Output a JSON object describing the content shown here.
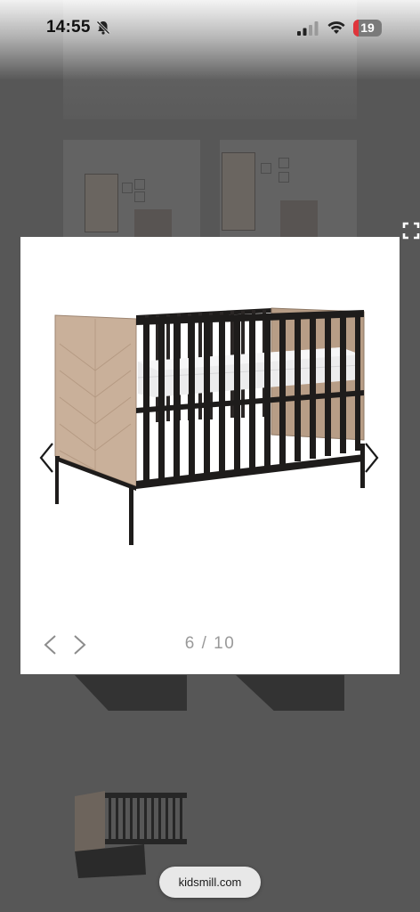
{
  "status_bar": {
    "time": "14:55",
    "battery_level": "19",
    "battery_fraction": 0.19,
    "icons": [
      "bell-off-icon",
      "signal-icon",
      "wifi-icon",
      "battery-icon"
    ]
  },
  "lightbox": {
    "counter": "6 / 10",
    "current_index": 6,
    "total": 10,
    "icons": [
      "chevron-left-icon",
      "chevron-right-icon",
      "fullscreen-icon"
    ]
  },
  "browser": {
    "url": "kidsmill.com"
  },
  "colors": {
    "overlay": "#575757",
    "lightbox_bg": "#ffffff",
    "crib_wood": "#c9b09a",
    "crib_bars": "#1e1c1b",
    "mattress": "#e9e9ea",
    "battery_low": "#e0353b",
    "counter_text": "#9a9a9a"
  }
}
